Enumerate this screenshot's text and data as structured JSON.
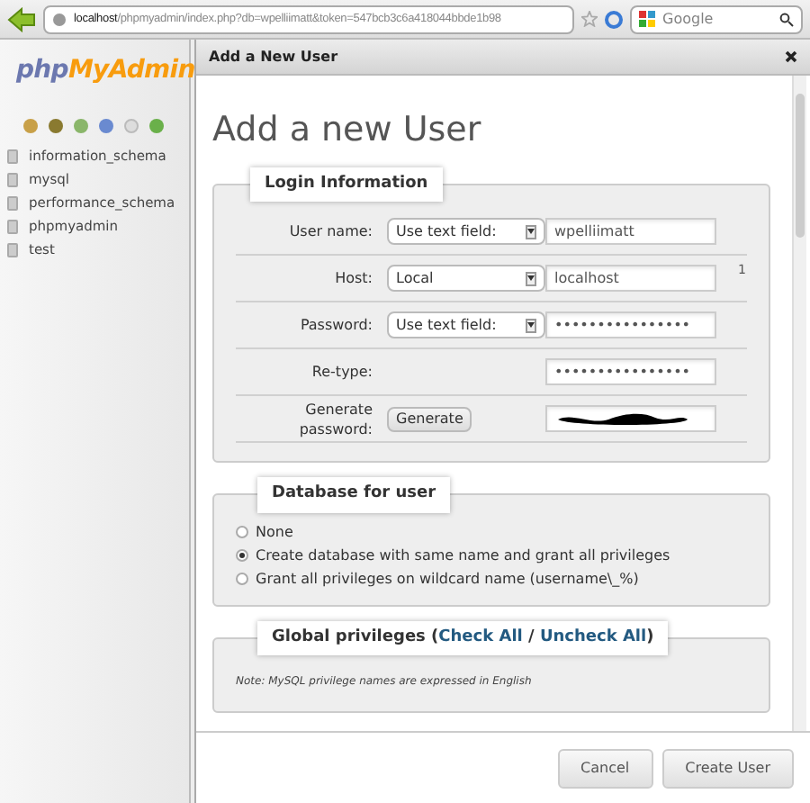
{
  "browser": {
    "url_host": "localhost",
    "url_path": "/phpmyadmin/index.php?db=wpelliimatt&token=547bcb3c6a418044bbde1b98",
    "search_placeholder": "Google"
  },
  "sidebar": {
    "logo_php": "php",
    "logo_myadmin": "MyAdmin",
    "databases": [
      "information_schema",
      "mysql",
      "performance_schema",
      "phpmyadmin",
      "test"
    ]
  },
  "dialog": {
    "title": "Add a New User",
    "heading": "Add a new User",
    "login": {
      "legend": "Login Information",
      "rows": [
        {
          "kind": "select",
          "label": "User name:",
          "select": "Use text field:",
          "value": "wpelliimatt"
        },
        {
          "kind": "select",
          "label": "Host:",
          "select": "Local",
          "value": "localhost",
          "note": "1"
        },
        {
          "kind": "select",
          "label": "Password:",
          "select": "Use text field:",
          "value": "••••••••••••••••"
        },
        {
          "kind": "plain",
          "label": "Re-type:",
          "value": "••••••••••••••••"
        },
        {
          "kind": "button",
          "label": "Generate password:",
          "button": "Generate",
          "redacted": true
        }
      ]
    },
    "database": {
      "legend": "Database for user",
      "options": [
        {
          "label": "None",
          "selected": false
        },
        {
          "label": "Create database with same name and grant all privileges",
          "selected": true
        },
        {
          "label": "Grant all privileges on wildcard name (username\\_%)",
          "selected": false
        }
      ]
    },
    "privileges": {
      "legend": "Global privileges (",
      "check_all": "Check All",
      "separator": " / ",
      "uncheck_all": "Uncheck All",
      "legend_end": ")",
      "note": "Note: MySQL privilege names are expressed in English"
    },
    "buttons": [
      "Cancel",
      "Create User"
    ]
  }
}
